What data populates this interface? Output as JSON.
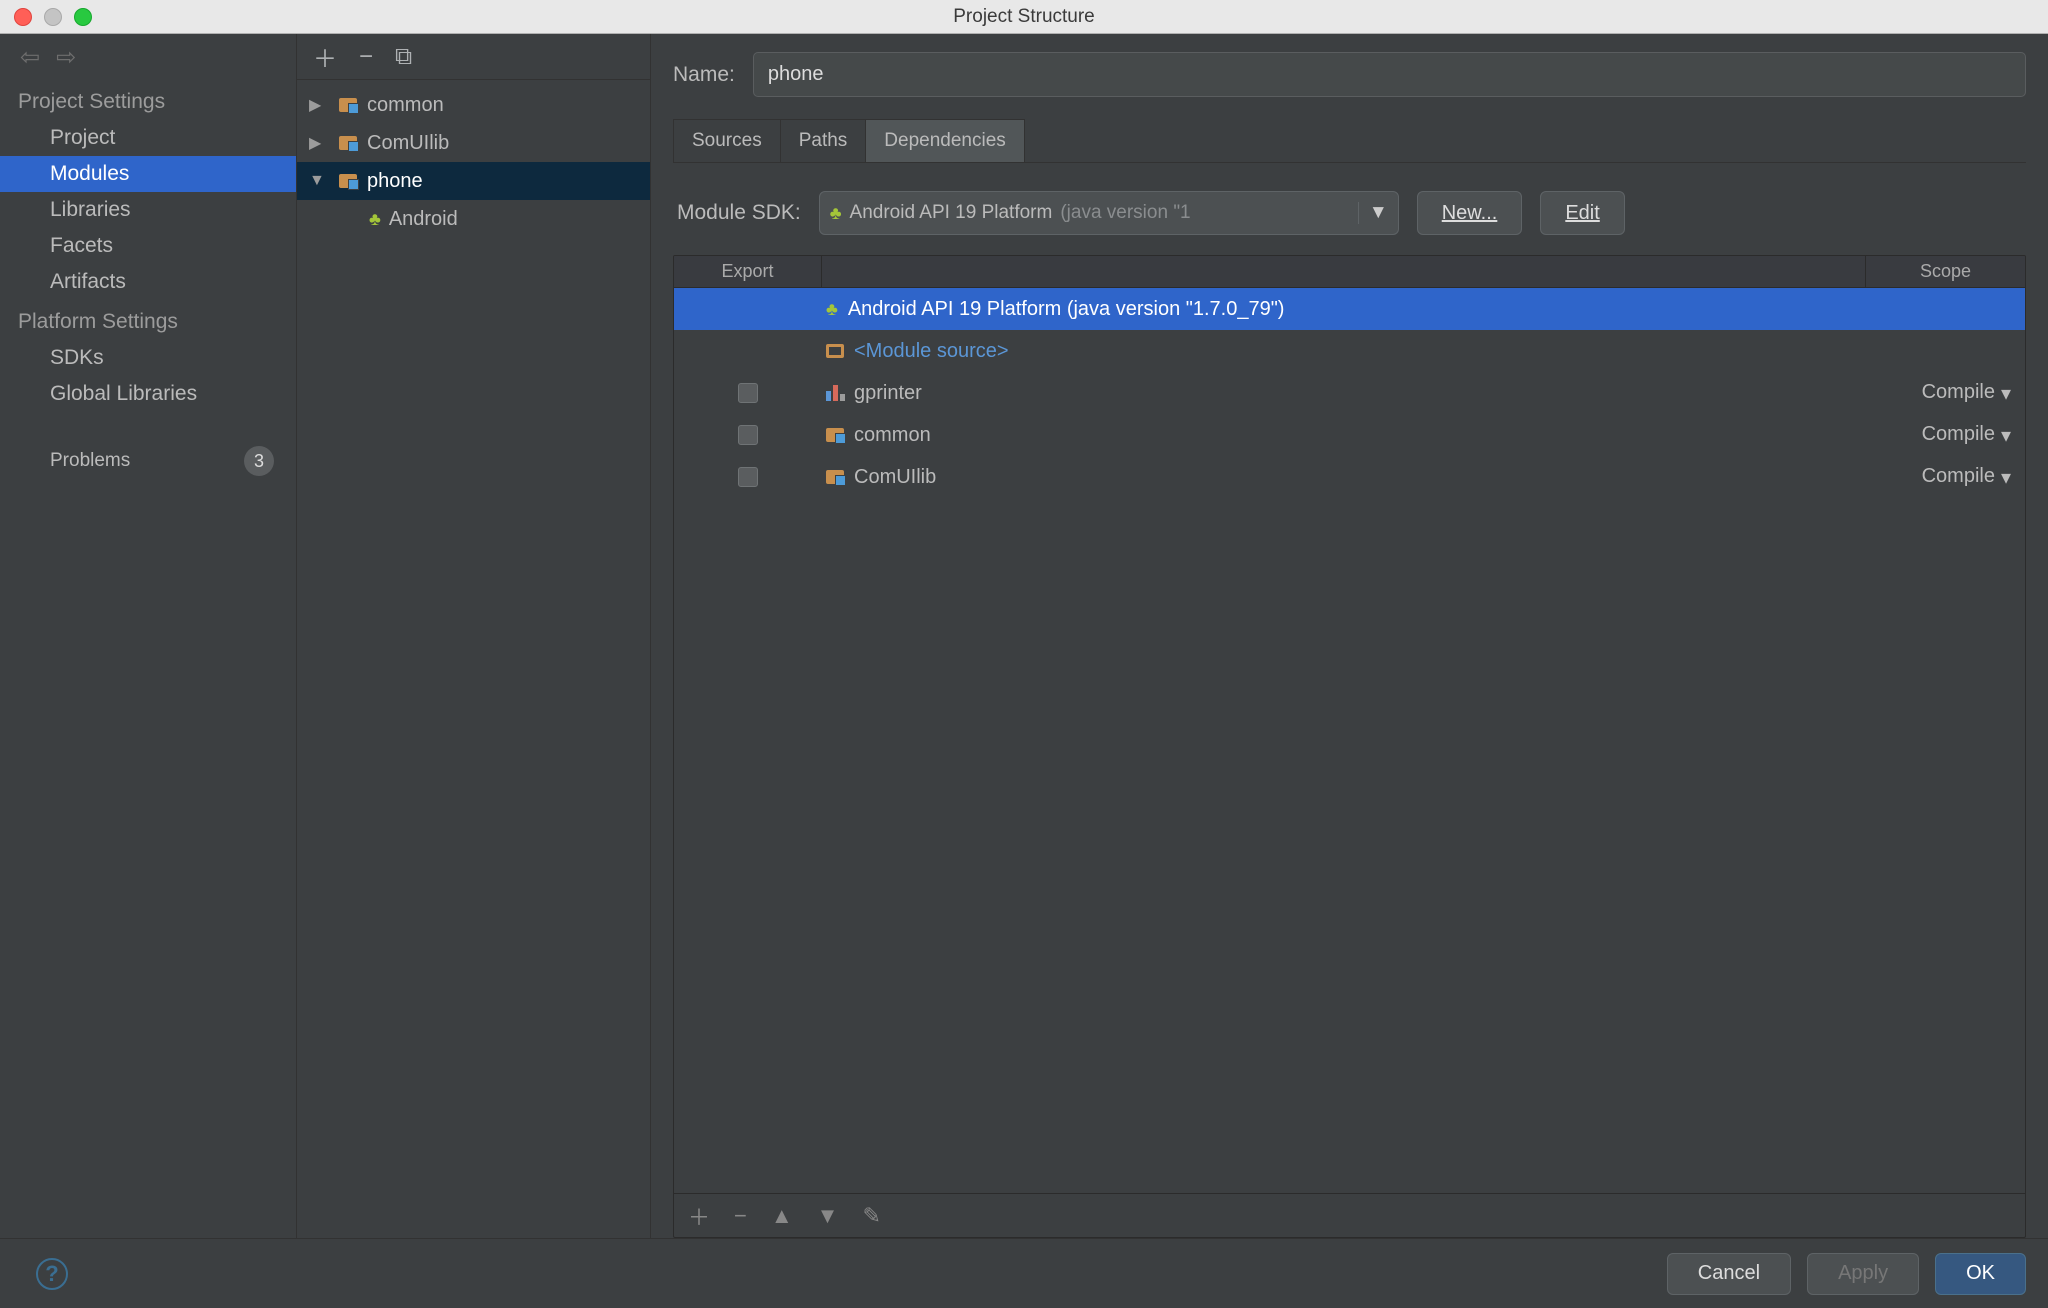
{
  "window": {
    "title": "Project Structure"
  },
  "sidebar": {
    "sections": [
      {
        "heading": "Project Settings",
        "items": [
          "Project",
          "Modules",
          "Libraries",
          "Facets",
          "Artifacts"
        ],
        "selected": 1
      },
      {
        "heading": "Platform Settings",
        "items": [
          "SDKs",
          "Global Libraries"
        ]
      }
    ],
    "problems": {
      "label": "Problems",
      "count": "3"
    }
  },
  "tree": {
    "items": [
      {
        "label": "common",
        "expanded": false,
        "selected": false,
        "type": "module"
      },
      {
        "label": "ComUIlib",
        "expanded": false,
        "selected": false,
        "type": "module"
      },
      {
        "label": "phone",
        "expanded": true,
        "selected": true,
        "type": "module",
        "children": [
          {
            "label": "Android",
            "type": "android"
          }
        ]
      }
    ]
  },
  "main": {
    "name_label": "Name:",
    "name_value": "phone",
    "tabs": [
      "Sources",
      "Paths",
      "Dependencies"
    ],
    "active_tab": 2,
    "sdk_label": "Module SDK:",
    "sdk_value": "Android API 19 Platform",
    "sdk_value_suffix": "(java version \"1",
    "new_btn": "New...",
    "edit_btn": "Edit",
    "table": {
      "headers": {
        "export": "Export",
        "scope": "Scope"
      },
      "rows": [
        {
          "icon": "android",
          "label": "Android API 19 Platform (java version \"1.7.0_79\")",
          "export": null,
          "scope": null,
          "selected": true
        },
        {
          "icon": "source",
          "label": "<Module source>",
          "export": null,
          "scope": null,
          "module_source": true
        },
        {
          "icon": "lib",
          "label": "gprinter",
          "export": false,
          "scope": "Compile"
        },
        {
          "icon": "module",
          "label": "common",
          "export": false,
          "scope": "Compile"
        },
        {
          "icon": "module",
          "label": "ComUIlib",
          "export": false,
          "scope": "Compile"
        }
      ]
    }
  },
  "footer": {
    "cancel": "Cancel",
    "apply": "Apply",
    "ok": "OK"
  }
}
